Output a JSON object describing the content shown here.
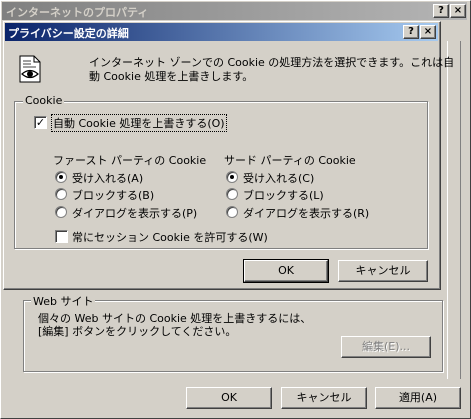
{
  "outer": {
    "title": "インターネットのプロパティ",
    "help_glyph": "?",
    "close_glyph": "×",
    "websites_group": {
      "label": "Web サイト",
      "description_line1": "個々の Web サイトの Cookie 処理を上書きするには、",
      "description_line2": "[編集] ボタンをクリックしてください。",
      "edit_button": "編集(E)..."
    },
    "buttons": {
      "ok": "OK",
      "cancel": "キャンセル",
      "apply": "適用(A)"
    }
  },
  "dialog": {
    "title": "プライバシー設定の詳細",
    "help_glyph": "?",
    "close_glyph": "×",
    "description_line1": "インターネット ゾーンでの Cookie の処理方法を選択できます。これは自",
    "description_line2": "動 Cookie 処理を上書きします。",
    "cookie_group": {
      "label": "Cookie",
      "override_checkbox": {
        "label": "自動 Cookie 処理を上書きする(O)",
        "checked": true
      },
      "first_party": {
        "heading": "ファースト パーティの Cookie",
        "options": [
          "受け入れる(A)",
          "ブロックする(B)",
          "ダイアログを表示する(P)"
        ],
        "selected": 0
      },
      "third_party": {
        "heading": "サード パーティの Cookie",
        "options": [
          "受け入れる(C)",
          "ブロックする(L)",
          "ダイアログを表示する(R)"
        ],
        "selected": 0
      },
      "session_checkbox": {
        "label": "常にセッション Cookie を許可する(W)",
        "checked": false
      }
    },
    "buttons": {
      "ok": "OK",
      "cancel": "キャンセル"
    }
  }
}
